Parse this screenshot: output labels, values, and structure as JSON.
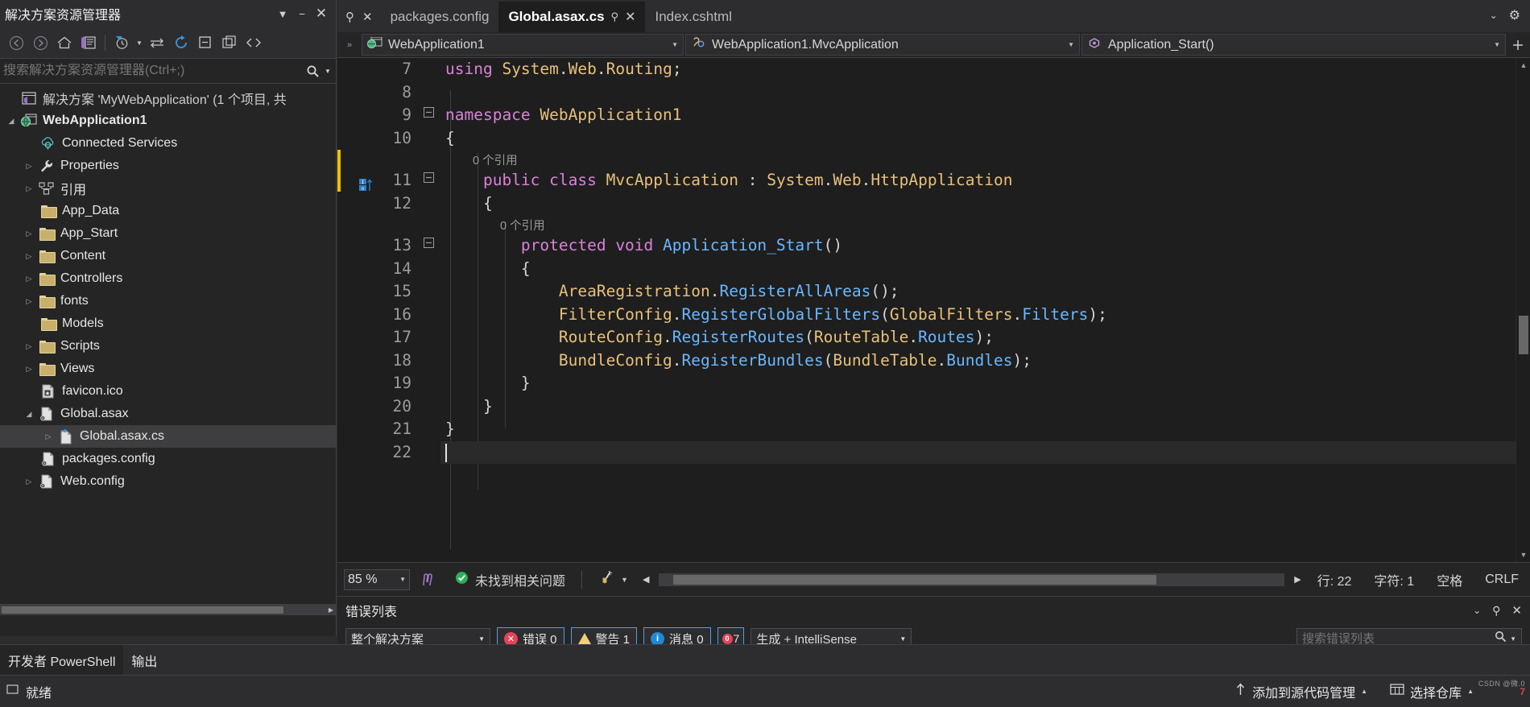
{
  "solution_explorer": {
    "title": "解决方案资源管理器",
    "dropdown_icon": "chevron-down-icon",
    "minimize_icon": "minimize-icon",
    "close_icon": "close-icon",
    "toolbar": [
      {
        "name": "back-icon",
        "glyph": "←"
      },
      {
        "name": "forward-icon",
        "glyph": "→"
      },
      {
        "name": "home-icon",
        "glyph": "⌂"
      },
      {
        "name": "solution-view-icon",
        "glyph": "▤"
      },
      {
        "name": "pending-changes-filter-icon",
        "glyph": "◷"
      },
      {
        "name": "sync-with-active-document-icon",
        "glyph": "⇆"
      },
      {
        "name": "refresh-icon",
        "glyph": "↻"
      },
      {
        "name": "collapse-all-icon",
        "glyph": "⊟"
      },
      {
        "name": "show-all-files-icon",
        "glyph": "❐"
      },
      {
        "name": "view-code-icon",
        "glyph": "<>"
      }
    ],
    "search_placeholder": "搜索解决方案资源管理器(Ctrl+;)",
    "tree": [
      {
        "label": "解决方案 'MyWebApplication' (1 个项目, 共",
        "icon": "solution-icon",
        "indent": 1,
        "expander": "",
        "bold": false
      },
      {
        "label": "WebApplication1",
        "icon": "web-project-icon",
        "indent": 1,
        "expander": "▼",
        "bold": true
      },
      {
        "label": "Connected Services",
        "icon": "connected-services-icon",
        "indent": 2,
        "expander": "",
        "bold": false
      },
      {
        "label": "Properties",
        "icon": "wrench-icon",
        "indent": 2,
        "expander": "▶",
        "bold": false
      },
      {
        "label": "引用",
        "icon": "references-icon",
        "indent": 2,
        "expander": "▶",
        "bold": false
      },
      {
        "label": "App_Data",
        "icon": "folder-icon",
        "indent": 2,
        "expander": "",
        "bold": false
      },
      {
        "label": "App_Start",
        "icon": "folder-icon",
        "indent": 2,
        "expander": "▶",
        "bold": false
      },
      {
        "label": "Content",
        "icon": "folder-icon",
        "indent": 2,
        "expander": "▶",
        "bold": false
      },
      {
        "label": "Controllers",
        "icon": "folder-icon",
        "indent": 2,
        "expander": "▶",
        "bold": false
      },
      {
        "label": "fonts",
        "icon": "folder-icon",
        "indent": 2,
        "expander": "▶",
        "bold": false
      },
      {
        "label": "Models",
        "icon": "folder-icon",
        "indent": 2,
        "expander": "",
        "bold": false
      },
      {
        "label": "Scripts",
        "icon": "folder-icon",
        "indent": 2,
        "expander": "▶",
        "bold": false
      },
      {
        "label": "Views",
        "icon": "folder-icon",
        "indent": 2,
        "expander": "▶",
        "bold": false
      },
      {
        "label": "favicon.ico",
        "icon": "ico-file-icon",
        "indent": 2,
        "expander": "",
        "bold": false
      },
      {
        "label": "Global.asax",
        "icon": "asax-file-icon",
        "indent": 2,
        "expander": "▼",
        "bold": false
      },
      {
        "label": "Global.asax.cs",
        "icon": "cs-file-icon",
        "indent": 3,
        "expander": "▶",
        "bold": false,
        "selected": true
      },
      {
        "label": "packages.config",
        "icon": "config-file-icon",
        "indent": 2,
        "expander": "",
        "bold": false
      },
      {
        "label": "Web.config",
        "icon": "config-file-icon",
        "indent": 2,
        "expander": "▶",
        "bold": false
      }
    ]
  },
  "editor": {
    "tabs": [
      {
        "label": "packages.config",
        "active": false,
        "closable": false
      },
      {
        "label": "Global.asax.cs",
        "active": true,
        "closable": true,
        "pin_icon": "pin-icon",
        "close_icon": "close-icon"
      },
      {
        "label": "Index.cshtml",
        "active": false,
        "closable": false
      }
    ],
    "tabstrip_right": [
      {
        "name": "tab-list-chevron-icon",
        "glyph": "⌄"
      },
      {
        "name": "settings-gear-icon",
        "glyph": "⚙"
      }
    ],
    "navbar": {
      "project": "WebApplication1",
      "type": "WebApplication1.MvcApplication",
      "member": "Application_Start()",
      "project_icon": "web-project-icon",
      "type_icon": "class-icon",
      "member_icon": "method-icon",
      "add_icon": "add-icon"
    },
    "code": [
      {
        "n": "7",
        "fold": "",
        "ref": "",
        "tokens": [
          {
            "t": "using ",
            "c": "k"
          },
          {
            "t": "System",
            "c": "ty"
          },
          {
            "t": ".",
            "c": "pl"
          },
          {
            "t": "Web",
            "c": "ty"
          },
          {
            "t": ".",
            "c": "pl"
          },
          {
            "t": "Routing",
            "c": "ty"
          },
          {
            "t": ";",
            "c": "pl"
          }
        ],
        "indentcol": 0
      },
      {
        "n": "8",
        "fold": "",
        "ref": "",
        "tokens": []
      },
      {
        "n": "9",
        "fold": "−",
        "ref": "",
        "tokens": [
          {
            "t": "namespace ",
            "c": "k"
          },
          {
            "t": "WebApplication1",
            "c": "ty"
          }
        ]
      },
      {
        "n": "10",
        "fold": "",
        "ref": "",
        "tokens": [
          {
            "t": "{",
            "c": "br"
          }
        ]
      },
      {
        "n": "11",
        "fold": "−",
        "ref": "0 个引用",
        "changed": true,
        "tokens": [
          {
            "t": "    ",
            "c": "pl"
          },
          {
            "t": "public class ",
            "c": "k"
          },
          {
            "t": "MvcApplication",
            "c": "ty"
          },
          {
            "t": " : ",
            "c": "pl"
          },
          {
            "t": "System",
            "c": "ty"
          },
          {
            "t": ".",
            "c": "pl"
          },
          {
            "t": "Web",
            "c": "ty"
          },
          {
            "t": ".",
            "c": "pl"
          },
          {
            "t": "HttpApplication",
            "c": "ty"
          }
        ]
      },
      {
        "n": "12",
        "fold": "",
        "ref": "",
        "tokens": [
          {
            "t": "    {",
            "c": "br"
          }
        ]
      },
      {
        "n": "13",
        "fold": "−",
        "ref": "0 个引用",
        "tokens": [
          {
            "t": "        ",
            "c": "pl"
          },
          {
            "t": "protected void ",
            "c": "k"
          },
          {
            "t": "Application_Start",
            "c": "mth"
          },
          {
            "t": "()",
            "c": "pl"
          }
        ]
      },
      {
        "n": "14",
        "fold": "",
        "ref": "",
        "tokens": [
          {
            "t": "        {",
            "c": "br"
          }
        ]
      },
      {
        "n": "15",
        "fold": "",
        "ref": "",
        "tokens": [
          {
            "t": "            ",
            "c": "pl"
          },
          {
            "t": "AreaRegistration",
            "c": "ty"
          },
          {
            "t": ".",
            "c": "pl"
          },
          {
            "t": "RegisterAllAreas",
            "c": "mth"
          },
          {
            "t": "();",
            "c": "pl"
          }
        ]
      },
      {
        "n": "16",
        "fold": "",
        "ref": "",
        "tokens": [
          {
            "t": "            ",
            "c": "pl"
          },
          {
            "t": "FilterConfig",
            "c": "ty"
          },
          {
            "t": ".",
            "c": "pl"
          },
          {
            "t": "RegisterGlobalFilters",
            "c": "mth"
          },
          {
            "t": "(",
            "c": "pl"
          },
          {
            "t": "GlobalFilters",
            "c": "ty"
          },
          {
            "t": ".",
            "c": "pl"
          },
          {
            "t": "Filters",
            "c": "mth"
          },
          {
            "t": ");",
            "c": "pl"
          }
        ]
      },
      {
        "n": "17",
        "fold": "",
        "ref": "",
        "tokens": [
          {
            "t": "            ",
            "c": "pl"
          },
          {
            "t": "RouteConfig",
            "c": "ty"
          },
          {
            "t": ".",
            "c": "pl"
          },
          {
            "t": "RegisterRoutes",
            "c": "mth"
          },
          {
            "t": "(",
            "c": "pl"
          },
          {
            "t": "RouteTable",
            "c": "ty"
          },
          {
            "t": ".",
            "c": "pl"
          },
          {
            "t": "Routes",
            "c": "mth"
          },
          {
            "t": ");",
            "c": "pl"
          }
        ]
      },
      {
        "n": "18",
        "fold": "",
        "ref": "",
        "tokens": [
          {
            "t": "            ",
            "c": "pl"
          },
          {
            "t": "BundleConfig",
            "c": "ty"
          },
          {
            "t": ".",
            "c": "pl"
          },
          {
            "t": "RegisterBundles",
            "c": "mth"
          },
          {
            "t": "(",
            "c": "pl"
          },
          {
            "t": "BundleTable",
            "c": "ty"
          },
          {
            "t": ".",
            "c": "pl"
          },
          {
            "t": "Bundles",
            "c": "mth"
          },
          {
            "t": ");",
            "c": "pl"
          }
        ]
      },
      {
        "n": "19",
        "fold": "",
        "ref": "",
        "tokens": [
          {
            "t": "        }",
            "c": "br"
          }
        ]
      },
      {
        "n": "20",
        "fold": "",
        "ref": "",
        "tokens": [
          {
            "t": "    }",
            "c": "br"
          }
        ]
      },
      {
        "n": "21",
        "fold": "",
        "ref": "",
        "tokens": [
          {
            "t": "}",
            "c": "br"
          }
        ]
      },
      {
        "n": "22",
        "fold": "",
        "ref": "",
        "tokens": [],
        "current": true
      }
    ],
    "status": {
      "zoom": "85 %",
      "ink_icon": "ink-annotation-icon",
      "issues": "未找到相关问题",
      "issues_icon": "check-circle-icon",
      "broom_icon": "code-cleanup-icon",
      "line_label": "行: 22",
      "char_label": "字符: 1",
      "spaces_label": "空格",
      "eol_label": "CRLF"
    }
  },
  "error_list": {
    "title": "错误列表",
    "scope": "整个解决方案",
    "errors": "错误 0",
    "warnings": "警告 1",
    "messages": "消息 0",
    "suppressed": "7",
    "build_filter": "生成 + IntelliSense",
    "search_placeholder": "搜索错误列表",
    "panel_icons": [
      {
        "name": "dropdown-chevron-icon",
        "glyph": "⌄"
      },
      {
        "name": "pin-icon",
        "glyph": "⚲"
      },
      {
        "name": "close-icon",
        "glyph": "✕"
      }
    ]
  },
  "dock_tabs": [
    {
      "label": "开发者 PowerShell",
      "active": true
    },
    {
      "label": "输出",
      "active": false
    }
  ],
  "vs_status": {
    "ready": "就绪",
    "ready_icon": "ready-icon",
    "source_control": "添加到源代码管理",
    "source_control_icon": "upload-arrow-icon",
    "repository": "选择仓库",
    "repository_icon": "repository-icon"
  },
  "watermark": {
    "line1": "CSDN @微.0",
    "line2": "7"
  },
  "colors": {
    "accent_blue": "#4f9fe0",
    "keyword": "#d882d8",
    "type": "#e8c07a",
    "method": "#69b7ff",
    "editor_bg": "#1e1e1e",
    "chrome_bg": "#2d2d30",
    "panel_bg": "#252526"
  }
}
